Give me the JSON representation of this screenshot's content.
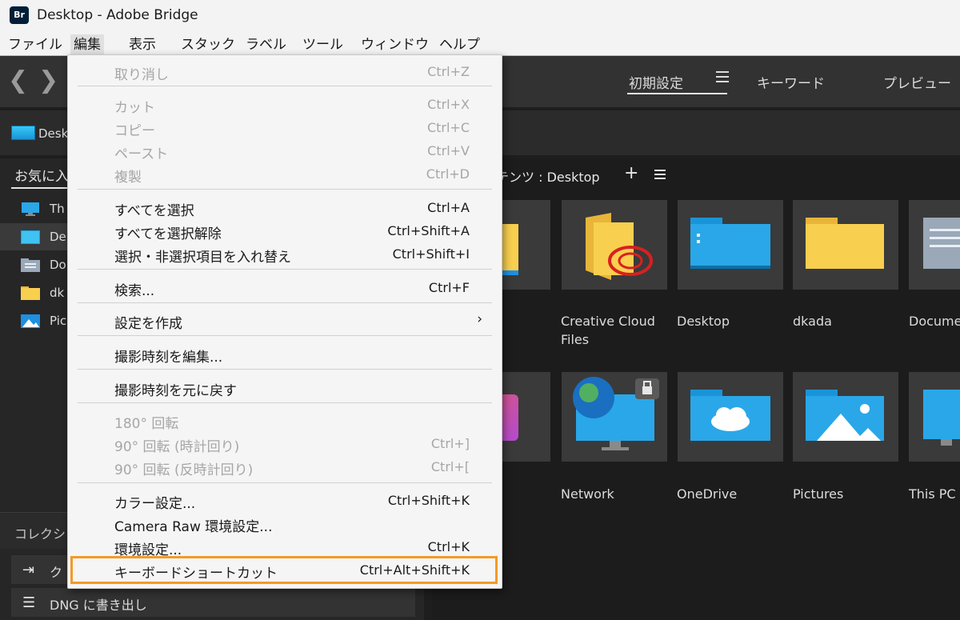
{
  "window": {
    "logo": "Br",
    "title": "Desktop - Adobe Bridge"
  },
  "menubar": {
    "items": [
      "ファイル",
      "編集",
      "表示",
      "スタック",
      "ラベル",
      "ツール",
      "ウィンドウ",
      "ヘルプ"
    ],
    "active": "編集"
  },
  "toolbar": {
    "back_icon": "chevron-left-icon",
    "forward_icon": "chevron-right-icon",
    "workspaces": [
      "初期設定",
      "キーワード",
      "プレビュー"
    ],
    "active_workspace": "初期設定"
  },
  "pathbar": {
    "label": "Desk"
  },
  "left_panel": {
    "tab": "お気に入",
    "items": [
      {
        "label": "Th",
        "icon": "computer-icon"
      },
      {
        "label": "De",
        "icon": "desktop-icon",
        "selected": true
      },
      {
        "label": "Do",
        "icon": "documents-icon"
      },
      {
        "label": "dk",
        "icon": "folder-icon"
      },
      {
        "label": "Pic",
        "icon": "pictures-icon"
      }
    ],
    "collections_tab": "コレクシ",
    "collection_items": [
      {
        "label": "ク",
        "icon": "export-icon"
      },
      {
        "label": "DNG に書き出し",
        "icon": "list-icon"
      }
    ]
  },
  "content": {
    "title": "テンツ : Desktop",
    "items": [
      {
        "label": "Creative Cloud Files",
        "icon": "creative-cloud-folder-icon"
      },
      {
        "label": "Desktop",
        "icon": "desktop-folder-icon"
      },
      {
        "label": "dkada",
        "icon": "folder-icon"
      },
      {
        "label": "Docume",
        "icon": "documents-icon"
      },
      {
        "label": "Network",
        "icon": "network-icon"
      },
      {
        "label": "OneDrive",
        "icon": "onedrive-icon"
      },
      {
        "label": "Pictures",
        "icon": "pictures-icon"
      },
      {
        "label": "This PC",
        "icon": "this-pc-icon"
      }
    ]
  },
  "edit_menu": {
    "items": [
      {
        "label": "取り消し",
        "shortcut": "Ctrl+Z",
        "enabled": false
      },
      {
        "label": "カット",
        "shortcut": "Ctrl+X",
        "enabled": false
      },
      {
        "label": "コピー",
        "shortcut": "Ctrl+C",
        "enabled": false
      },
      {
        "label": "ペースト",
        "shortcut": "Ctrl+V",
        "enabled": false
      },
      {
        "label": "複製",
        "shortcut": "Ctrl+D",
        "enabled": false
      },
      {
        "label": "すべてを選択",
        "shortcut": "Ctrl+A",
        "enabled": true
      },
      {
        "label": "すべてを選択解除",
        "shortcut": "Ctrl+Shift+A",
        "enabled": true
      },
      {
        "label": "選択・非選択項目を入れ替え",
        "shortcut": "Ctrl+Shift+I",
        "enabled": true
      },
      {
        "label": "検索...",
        "shortcut": "Ctrl+F",
        "enabled": true
      },
      {
        "label": "設定を作成",
        "shortcut": "",
        "enabled": true,
        "submenu": true
      },
      {
        "label": "撮影時刻を編集...",
        "shortcut": "",
        "enabled": true
      },
      {
        "label": "撮影時刻を元に戻す",
        "shortcut": "",
        "enabled": true
      },
      {
        "label": "180° 回転",
        "shortcut": "",
        "enabled": false
      },
      {
        "label": "90° 回転 (時計回り)",
        "shortcut": "Ctrl+]",
        "enabled": false
      },
      {
        "label": "90° 回転 (反時計回り)",
        "shortcut": "Ctrl+[",
        "enabled": false
      },
      {
        "label": "カラー設定...",
        "shortcut": "Ctrl+Shift+K",
        "enabled": true
      },
      {
        "label": "Camera Raw 環境設定...",
        "shortcut": "",
        "enabled": true
      },
      {
        "label": "環境設定...",
        "shortcut": "Ctrl+K",
        "enabled": true
      },
      {
        "label": "キーボードショートカット",
        "shortcut": "Ctrl+Alt+Shift+K",
        "enabled": true,
        "highlighted": true
      }
    ],
    "submenu_arrow": "›",
    "highlight_color": "#f39a28"
  }
}
